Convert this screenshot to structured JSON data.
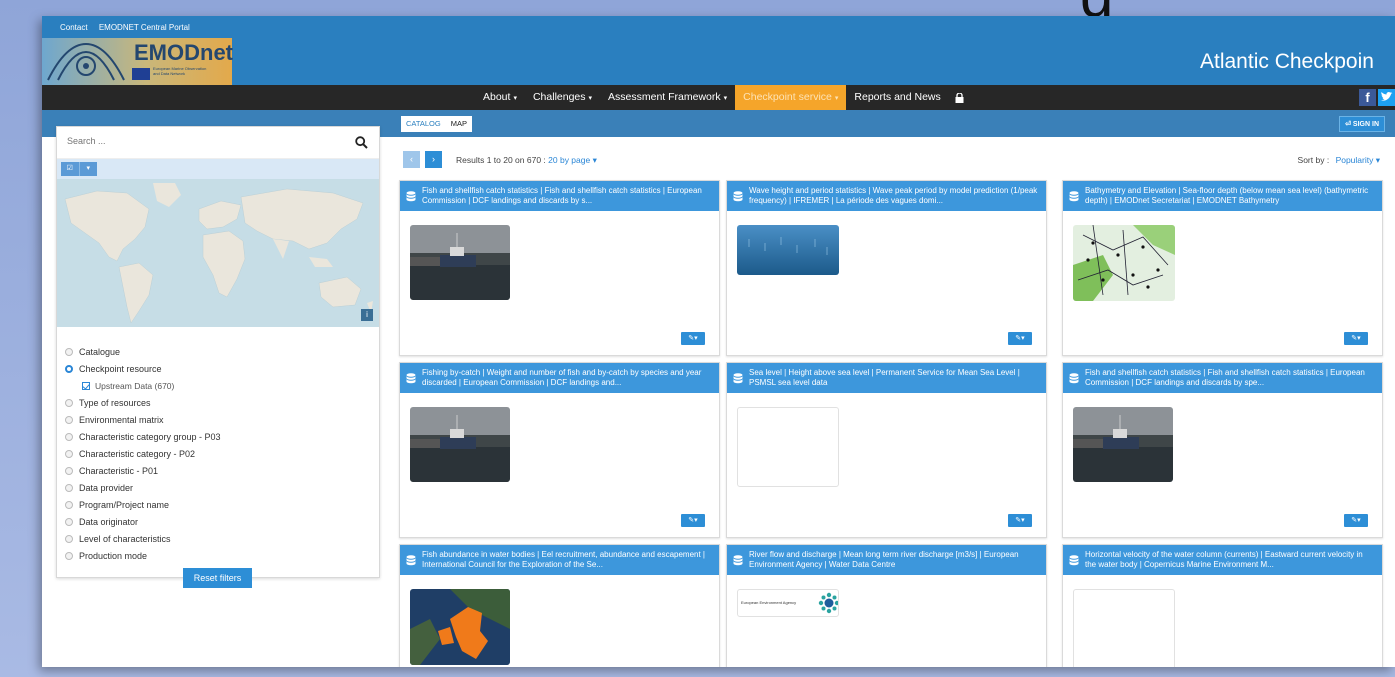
{
  "slide_title_fragment": "g",
  "header": {
    "top_links": [
      "Contact",
      "EMODNET Central Portal"
    ],
    "logo_text": "EMODnet",
    "logo_sub": "European Marine Observation and Data Network",
    "site_title": "Atlantic Checkpoin"
  },
  "nav": {
    "items": [
      {
        "label": "About",
        "caret": "▾"
      },
      {
        "label": "Challenges",
        "caret": "▾"
      },
      {
        "label": "Assessment Framework",
        "caret": "▾"
      },
      {
        "label": "Checkpoint service",
        "caret": "▾"
      },
      {
        "label": "Reports and News",
        "caret": ""
      }
    ],
    "facebook": "f"
  },
  "view_tabs": {
    "catalog": "CATALOG",
    "map": "MAP"
  },
  "signin": "⏎ SIGN IN",
  "sidebar": {
    "search_placeholder": "Search ...",
    "tool_buttons": [
      "☑",
      "▾"
    ],
    "map_info": "i",
    "filters": {
      "catalogue": "Catalogue",
      "checkpoint_resource": "Checkpoint resource",
      "upstream_data": "Upstream Data (670)",
      "type_of_resources": "Type of resources",
      "environmental_matrix": "Environmental matrix",
      "char_cat_group": "Characteristic category group - P03",
      "char_cat": "Characteristic category - P02",
      "characteristic": "Characteristic - P01",
      "data_provider": "Data provider",
      "program": "Program/Project name",
      "data_originator": "Data originator",
      "level": "Level of characteristics",
      "production_mode": "Production mode"
    },
    "reset": "Reset filters"
  },
  "results": {
    "prev": "‹",
    "next": "›",
    "prefix": "Results 1 to 20 on 670 :",
    "per_page": "20 by page ▾",
    "sort_label": "Sort by :",
    "sort_value": "Popularity ▾"
  },
  "cards": [
    {
      "title": "Fish and shellfish catch statistics | Fish and shellfish catch statistics | European Commission | DCF landings and discards by s..."
    },
    {
      "title": "Wave height and period statistics | Wave peak period by model prediction (1/peak frequency) | IFREMER | La période des vagues domi..."
    },
    {
      "title": "Bathymetry and Elevation | Sea-floor depth (below mean sea level) (bathymetric depth) | EMODnet Secretariat | EMODNET Bathymetry"
    },
    {
      "title": "Fishing by-catch | Weight and number of fish and by-catch by species and year discarded | European Commission | DCF landings and..."
    },
    {
      "title": "Sea level | Height above sea level | Permanent Service for Mean Sea Level | PSMSL sea level data"
    },
    {
      "title": "Fish and shellfish catch statistics | Fish and shellfish catch statistics | European Commission | DCF landings and discards by spe..."
    },
    {
      "title": "Fish abundance in water bodies | Eel recruitment, abundance and escapement | International Council for the Exploration of the Se..."
    },
    {
      "title": "River flow and discharge | Mean long term river discharge [m3/s] | European Environment Agency | Water Data Centre",
      "logo_text": "European Environment Agency"
    },
    {
      "title": "Horizontal velocity of the water column (currents) | Eastward current velocity in the water body | Copernicus Marine Environment M..."
    }
  ],
  "card_action": "✎▾"
}
